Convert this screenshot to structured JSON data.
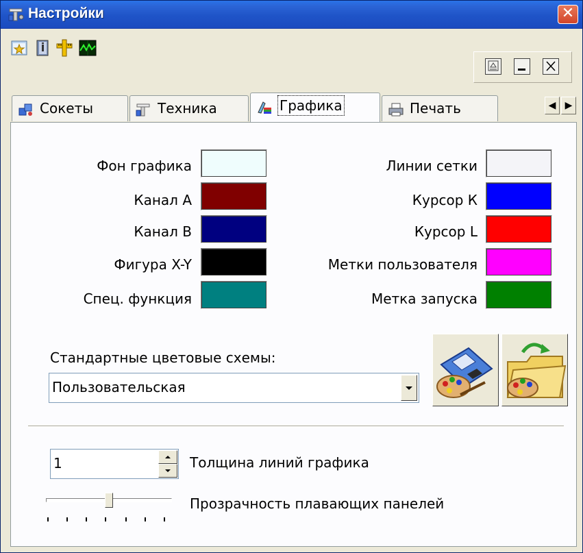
{
  "window": {
    "title": "Настройки"
  },
  "toolbar": {
    "icons": [
      "favorites-icon",
      "info-book-icon",
      "ruler-icon",
      "oscilloscope-icon"
    ]
  },
  "tabs": [
    {
      "label": "Сокеты",
      "icon": "sockets-icon"
    },
    {
      "label": "Техника",
      "icon": "equipment-icon"
    },
    {
      "label": "Графика",
      "icon": "graphics-icon",
      "active": true
    },
    {
      "label": "Печать",
      "icon": "printer-icon"
    }
  ],
  "colors_left": [
    {
      "label": "Фон графика",
      "color": "#effdfd"
    },
    {
      "label": "Канал А",
      "color": "#800000"
    },
    {
      "label": "Канал В",
      "color": "#000080"
    },
    {
      "label": "Фигура X-Y",
      "color": "#000000"
    },
    {
      "label": "Спец. функция",
      "color": "#008080"
    }
  ],
  "colors_right": [
    {
      "label": "Линии сетки",
      "color": "#f4f4f8"
    },
    {
      "label": "Курсор К",
      "color": "#0000ff"
    },
    {
      "label": "Курсор L",
      "color": "#ff0000"
    },
    {
      "label": "Метки пользователя",
      "color": "#ff00ff"
    },
    {
      "label": "Метка запуска",
      "color": "#008000"
    }
  ],
  "schemes": {
    "label": "Стандартные цветовые схемы:",
    "selected": "Пользовательская"
  },
  "line_width": {
    "value": "1",
    "label": "Толщина линий графика"
  },
  "transparency": {
    "label": "Прозрачность плавающих панелей",
    "level": 0.5
  }
}
